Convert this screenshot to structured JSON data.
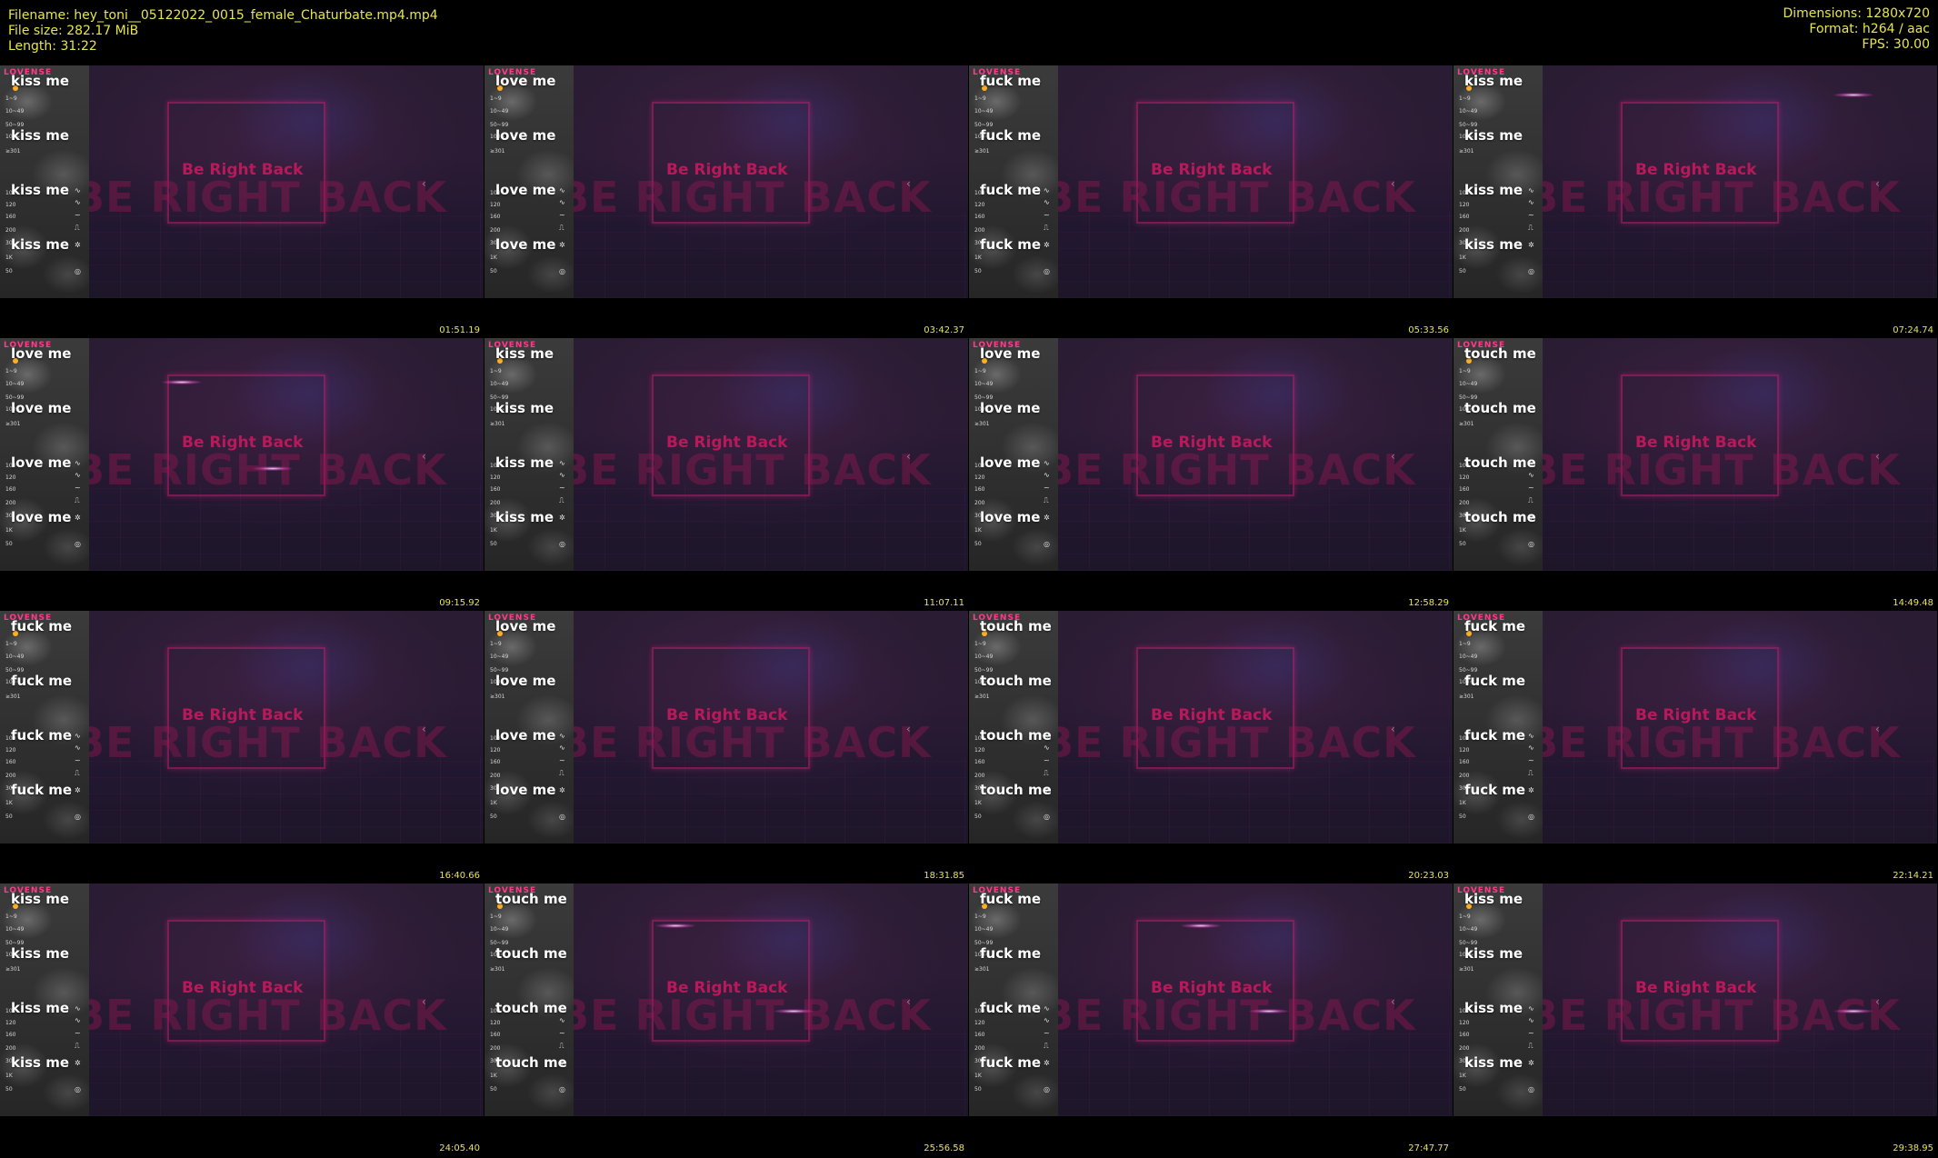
{
  "header": {
    "filename_line": "Filename: hey_toni__05122022_0015_female_Chaturbate.mp4.mp4",
    "filesize_line": "File size: 282.17 MiB",
    "length_line": "Length: 31:22",
    "dimensions_line": "Dimensions: 1280x720",
    "format_line": "Format: h264 / aac",
    "fps_line": "FPS: 30.00"
  },
  "frame_text": {
    "brand": "LOVENSE",
    "brb_small": "Be Right Back",
    "brb_large": "BE RIGHT BACK"
  },
  "thumbnails": [
    {
      "timestamp": "01:51.19",
      "phrase": "kiss me"
    },
    {
      "timestamp": "03:42.37",
      "phrase": "love me"
    },
    {
      "timestamp": "05:33.56",
      "phrase": "fuck me"
    },
    {
      "timestamp": "07:24.74",
      "phrase": "kiss me"
    },
    {
      "timestamp": "09:15.92",
      "phrase": "love me"
    },
    {
      "timestamp": "11:07.11",
      "phrase": "kiss me"
    },
    {
      "timestamp": "12:58.29",
      "phrase": "love me"
    },
    {
      "timestamp": "14:49.48",
      "phrase": "touch me"
    },
    {
      "timestamp": "16:40.66",
      "phrase": "fuck me"
    },
    {
      "timestamp": "18:31.85",
      "phrase": "love me"
    },
    {
      "timestamp": "20:23.03",
      "phrase": "touch me"
    },
    {
      "timestamp": "22:14.21",
      "phrase": "fuck me"
    },
    {
      "timestamp": "24:05.40",
      "phrase": "kiss me"
    },
    {
      "timestamp": "25:56.58",
      "phrase": "touch me"
    },
    {
      "timestamp": "27:47.77",
      "phrase": "fuck me"
    },
    {
      "timestamp": "29:38.95",
      "phrase": "kiss me"
    }
  ],
  "colors": {
    "header_text": "#e6e64a",
    "timestamp_text": "#e6e64a",
    "brb_pink": "#b8195a",
    "lovense_pink": "#ff3a8c"
  }
}
